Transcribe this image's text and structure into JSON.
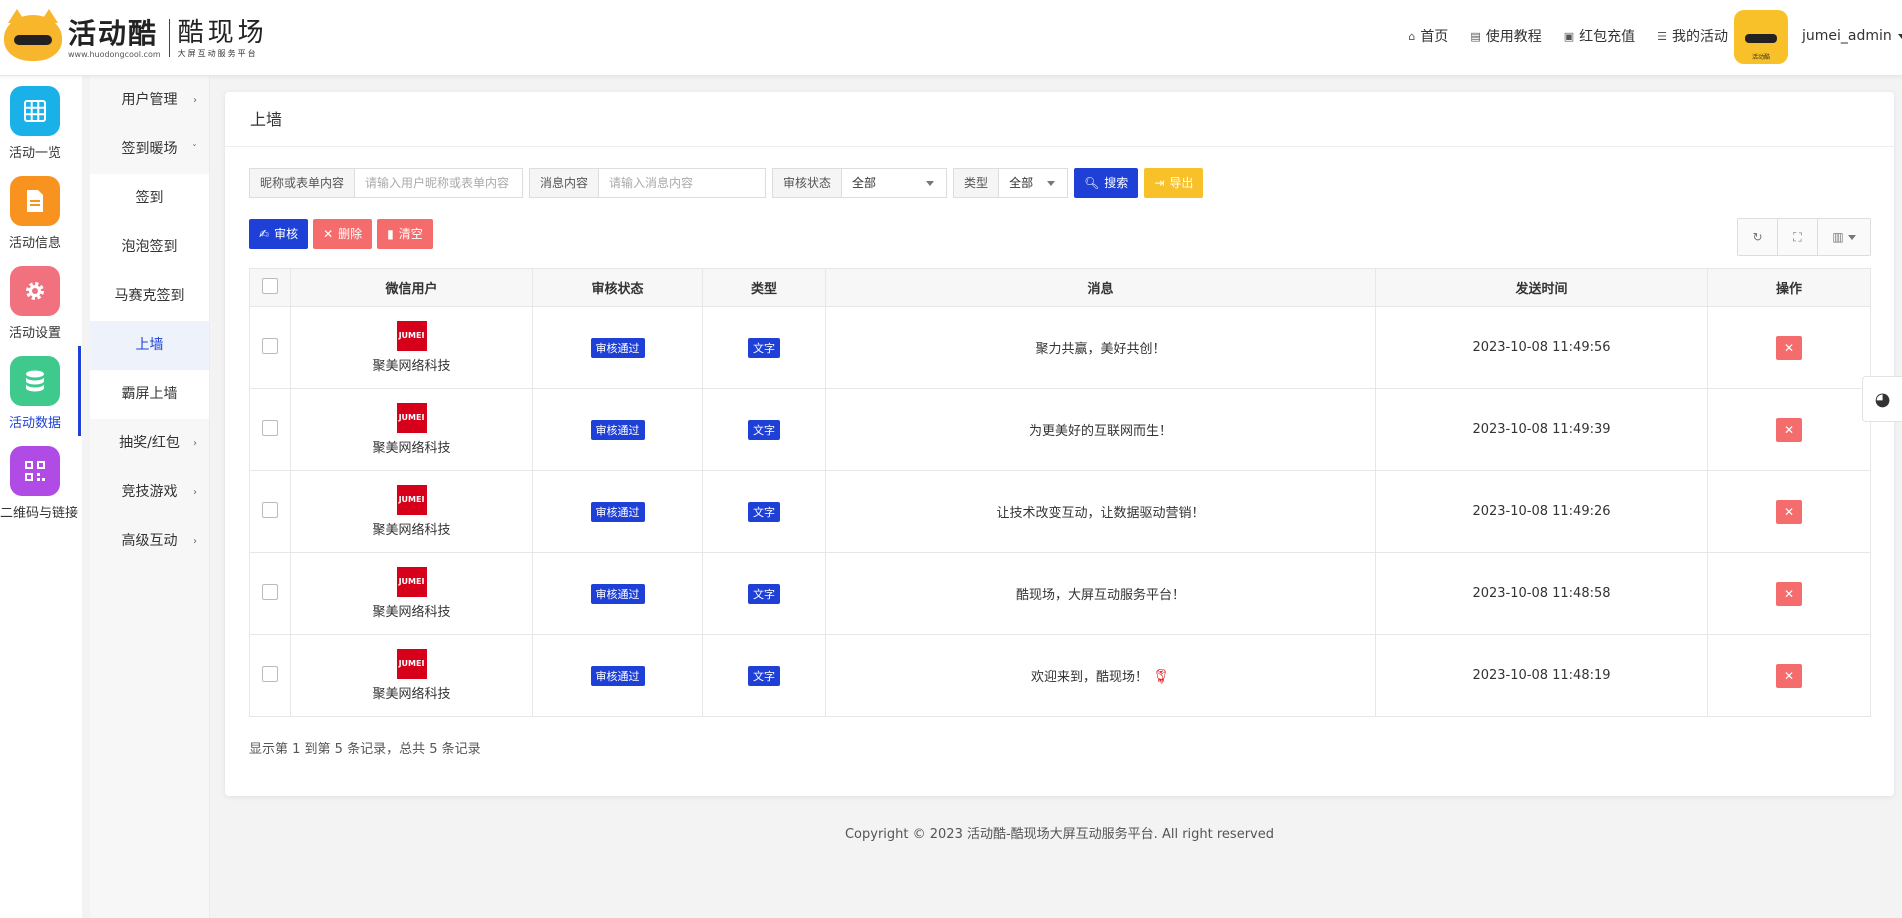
{
  "brand": {
    "logo_text": "活动酷",
    "logo_url": "www.huodongcool.com",
    "sub_title": "酷现场",
    "sub_tagline": "大屏互动服务平台"
  },
  "topnav": [
    {
      "label": "首页",
      "icon": "home-icon"
    },
    {
      "label": "使用教程",
      "icon": "book-icon"
    },
    {
      "label": "红包充值",
      "icon": "wallet-icon"
    },
    {
      "label": "我的活动",
      "icon": "list-icon"
    }
  ],
  "user": {
    "name": "jumei_admin",
    "avatar_text": "活动酷"
  },
  "icon_sidebar": [
    {
      "label": "活动一览",
      "color": "#1ab1e8",
      "icon": "grid-icon"
    },
    {
      "label": "活动信息",
      "color": "#f7931e",
      "icon": "document-icon"
    },
    {
      "label": "活动设置",
      "color": "#f1727e",
      "icon": "gear-icon"
    },
    {
      "label": "活动数据",
      "color": "#3fc98c",
      "icon": "database-icon",
      "active": true
    },
    {
      "label": "二维码与链接",
      "color": "#b04be6",
      "icon": "qrcode-icon"
    }
  ],
  "submenu": [
    {
      "label": "用户管理",
      "arrow": "›"
    },
    {
      "label": "签到暖场",
      "arrow": "ˇ"
    },
    {
      "label": "签到",
      "child": true
    },
    {
      "label": "泡泡签到",
      "child": true
    },
    {
      "label": "马赛克签到",
      "child": true
    },
    {
      "label": "上墙",
      "child": true,
      "active": true
    },
    {
      "label": "霸屏上墙",
      "child": true
    },
    {
      "label": "抽奖/红包",
      "arrow": "›"
    },
    {
      "label": "竞技游戏",
      "arrow": "›"
    },
    {
      "label": "高级互动",
      "arrow": "›"
    }
  ],
  "page": {
    "title": "上墙",
    "filters": {
      "nickname_label": "昵称或表单内容",
      "nickname_placeholder": "请输入用户昵称或表单内容",
      "message_label": "消息内容",
      "message_placeholder": "请输入消息内容",
      "status_label": "审核状态",
      "status_value": "全部",
      "type_label": "类型",
      "type_value": "全部",
      "search_label": "搜索",
      "export_label": "导出"
    },
    "actions": {
      "approve": "审核",
      "delete": "删除",
      "clear": "清空"
    },
    "columns": [
      "微信用户",
      "审核状态",
      "类型",
      "消息",
      "发送时间",
      "操作"
    ],
    "rows": [
      {
        "user": "聚美网络科技",
        "status": "审核通过",
        "type": "文字",
        "message": "聚力共赢，美好共创！",
        "time": "2023-10-08 11:49:56"
      },
      {
        "user": "聚美网络科技",
        "status": "审核通过",
        "type": "文字",
        "message": "为更美好的互联网而生！",
        "time": "2023-10-08 11:49:39"
      },
      {
        "user": "聚美网络科技",
        "status": "审核通过",
        "type": "文字",
        "message": "让技术改变互动，让数据驱动营销！",
        "time": "2023-10-08 11:49:26"
      },
      {
        "user": "聚美网络科技",
        "status": "审核通过",
        "type": "文字",
        "message": "酷现场，大屏互动服务平台！",
        "time": "2023-10-08 11:48:58"
      },
      {
        "user": "聚美网络科技",
        "status": "审核通过",
        "type": "文字",
        "message": "欢迎来到，酷现场！",
        "time": "2023-10-08 11:48:19",
        "emoji": "rose"
      }
    ],
    "avatar_text": "JUMEI",
    "summary": "显示第 1 到第 5 条记录，总共 5 条记录"
  },
  "footer": "Copyright © 2023 活动酷-酷现场大屏互动服务平台. All right reserved"
}
